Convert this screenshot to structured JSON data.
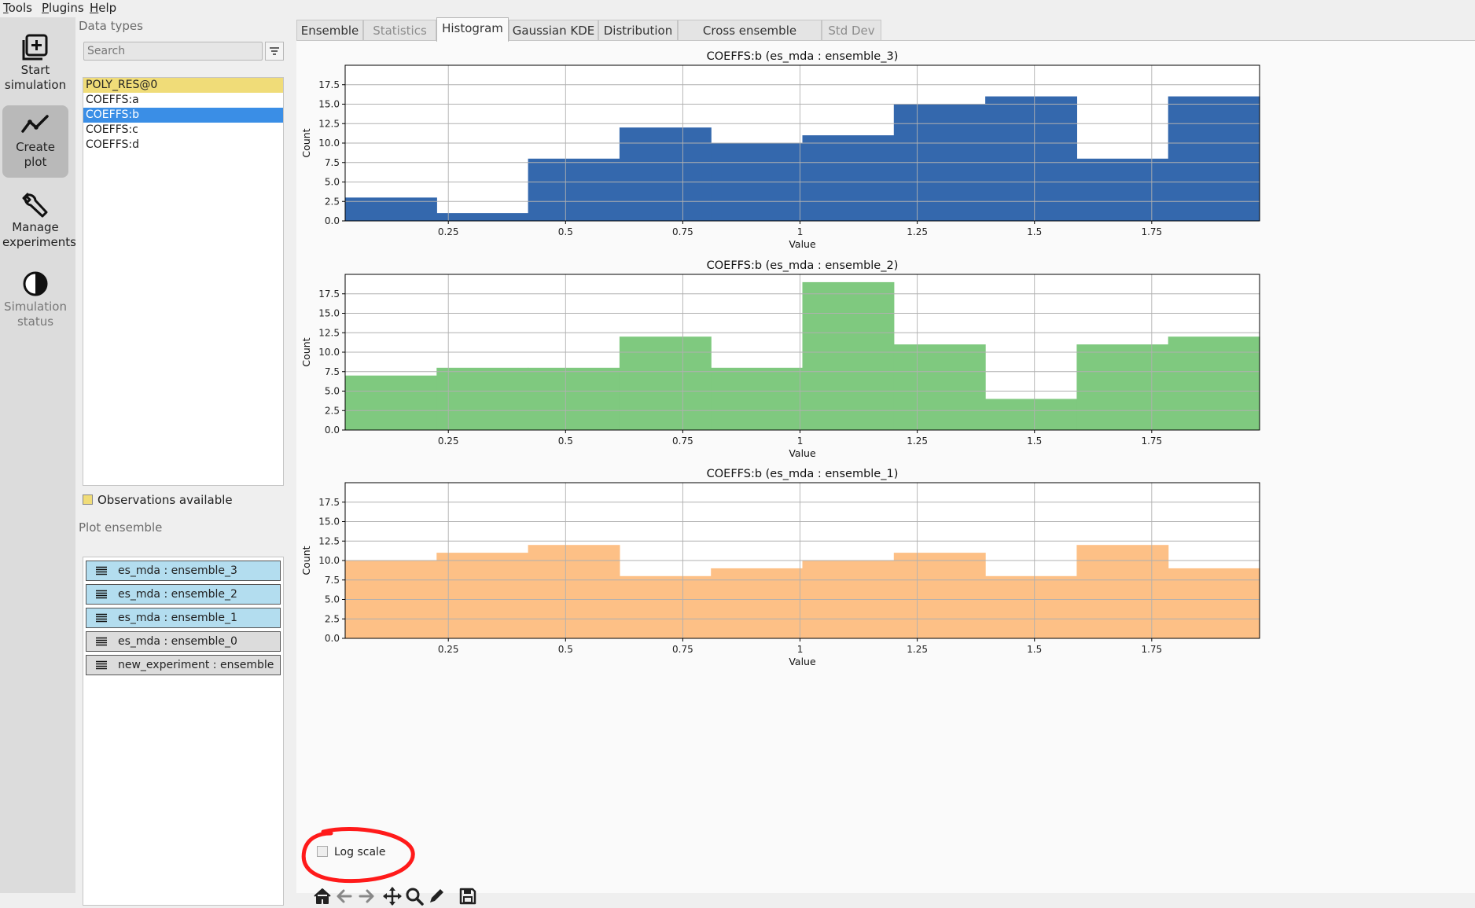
{
  "menubar": {
    "items": [
      {
        "first": "T",
        "rest": "ools"
      },
      {
        "first": "P",
        "rest": "lugins"
      },
      {
        "first": "H",
        "rest": "elp"
      }
    ]
  },
  "toolrail": {
    "buttons": [
      {
        "label1": "Start",
        "label2": "simulation",
        "icon": "plus-square-icon",
        "state": "normal"
      },
      {
        "label1": "Create",
        "label2": "plot",
        "icon": "line-chart-icon",
        "state": "active"
      },
      {
        "label1": "Manage",
        "label2": "experiments",
        "icon": "wrench-icon",
        "state": "normal"
      },
      {
        "label1": "Simulation",
        "label2": "status",
        "icon": "half-circle-icon",
        "state": "disabled"
      }
    ]
  },
  "data_types": {
    "heading": "Data types",
    "search_placeholder": "Search",
    "items": [
      "POLY_RES@0",
      "COEFFS:a",
      "COEFFS:b",
      "COEFFS:c",
      "COEFFS:d"
    ],
    "observation_item": "POLY_RES@0",
    "selected_item": "COEFFS:b",
    "observations_label": "Observations available",
    "observation_color": "#f0dc78"
  },
  "plot_ensemble": {
    "heading": "Plot ensemble",
    "items": [
      {
        "label": "es_mda : ensemble_3",
        "selected": true
      },
      {
        "label": "es_mda : ensemble_2",
        "selected": true
      },
      {
        "label": "es_mda : ensemble_1",
        "selected": true
      },
      {
        "label": "es_mda : ensemble_0",
        "selected": false
      },
      {
        "label": "new_experiment : ensemble",
        "selected": false
      }
    ]
  },
  "tabs": [
    {
      "label": "Ensemble",
      "state": "normal"
    },
    {
      "label": "Statistics",
      "state": "disabled"
    },
    {
      "label": "Histogram",
      "state": "active"
    },
    {
      "label": "Gaussian KDE",
      "state": "normal"
    },
    {
      "label": "Distribution",
      "state": "normal"
    },
    {
      "label": "Cross ensemble statistics",
      "state": "normal"
    },
    {
      "label": "Std Dev",
      "state": "disabled"
    }
  ],
  "chart_data": [
    {
      "type": "bar",
      "title": "COEFFS:b (es_mda : ensemble_3)",
      "xlabel": "Value",
      "ylabel": "Count",
      "bin_edges": [
        0.03,
        0.225,
        0.42,
        0.615,
        0.81,
        1.005,
        1.2,
        1.395,
        1.59,
        1.785,
        1.98
      ],
      "values": [
        3,
        1,
        8,
        12,
        10,
        11,
        15,
        16,
        8,
        16
      ],
      "color": "#3468ad",
      "xlim": [
        0.03,
        1.98
      ],
      "ylim": [
        0,
        20
      ],
      "xticks": [
        0.25,
        0.5,
        0.75,
        1,
        1.25,
        1.5,
        1.75
      ],
      "xtick_labels": [
        "0.25",
        "0.5",
        "0.75",
        "1",
        "1.25",
        "1.5",
        "1.75"
      ],
      "yticks": [
        0,
        2.5,
        5,
        7.5,
        10,
        12.5,
        15,
        17.5
      ],
      "ytick_labels": [
        "0.0",
        "2.5",
        "5.0",
        "7.5",
        "10.0",
        "12.5",
        "15.0",
        "17.5"
      ],
      "grid": true
    },
    {
      "type": "bar",
      "title": "COEFFS:b (es_mda : ensemble_2)",
      "xlabel": "Value",
      "ylabel": "Count",
      "bin_edges": [
        0.03,
        0.225,
        0.42,
        0.615,
        0.81,
        1.005,
        1.2,
        1.395,
        1.59,
        1.785,
        1.98
      ],
      "values": [
        7,
        8,
        8,
        12,
        8,
        19,
        11,
        4,
        11,
        12
      ],
      "color": "#7fc97f",
      "xlim": [
        0.03,
        1.98
      ],
      "ylim": [
        0,
        20
      ],
      "xticks": [
        0.25,
        0.5,
        0.75,
        1,
        1.25,
        1.5,
        1.75
      ],
      "xtick_labels": [
        "0.25",
        "0.5",
        "0.75",
        "1",
        "1.25",
        "1.5",
        "1.75"
      ],
      "yticks": [
        0,
        2.5,
        5,
        7.5,
        10,
        12.5,
        15,
        17.5
      ],
      "ytick_labels": [
        "0.0",
        "2.5",
        "5.0",
        "7.5",
        "10.0",
        "12.5",
        "15.0",
        "17.5"
      ],
      "grid": true
    },
    {
      "type": "bar",
      "title": "COEFFS:b (es_mda : ensemble_1)",
      "xlabel": "Value",
      "ylabel": "Count",
      "bin_edges": [
        0.03,
        0.225,
        0.42,
        0.615,
        0.81,
        1.005,
        1.2,
        1.395,
        1.59,
        1.785,
        1.98
      ],
      "values": [
        10,
        11,
        12,
        8,
        9,
        10,
        11,
        8,
        12,
        9
      ],
      "color": "#fdc086",
      "xlim": [
        0.03,
        1.98
      ],
      "ylim": [
        0,
        20
      ],
      "xticks": [
        0.25,
        0.5,
        0.75,
        1,
        1.25,
        1.5,
        1.75
      ],
      "xtick_labels": [
        "0.25",
        "0.5",
        "0.75",
        "1",
        "1.25",
        "1.5",
        "1.75"
      ],
      "yticks": [
        0,
        2.5,
        5,
        7.5,
        10,
        12.5,
        15,
        17.5
      ],
      "ytick_labels": [
        "0.0",
        "2.5",
        "5.0",
        "7.5",
        "10.0",
        "12.5",
        "15.0",
        "17.5"
      ],
      "grid": true
    }
  ],
  "log_scale": {
    "label": "Log scale",
    "checked": false
  },
  "annotation": {
    "color": "#ff1a1a"
  },
  "nav_toolbar": {
    "icons": [
      "home-icon",
      "back-arrow-icon",
      "forward-arrow-icon",
      "pan-icon",
      "zoom-icon",
      "edit-axes-icon",
      "save-icon"
    ]
  }
}
